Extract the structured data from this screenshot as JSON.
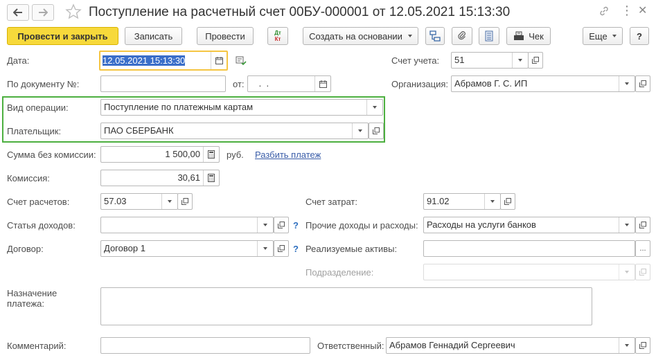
{
  "window": {
    "title": "Поступление на расчетный счет 00БУ-000001 от 12.05.2021 15:13:30",
    "more_icon": "⋮",
    "close_icon": "✕"
  },
  "toolbar": {
    "post_close": "Провести и закрыть",
    "save": "Записать",
    "post": "Провести",
    "dtkt_top": "Дт",
    "dtkt_bottom": "Кт",
    "create_based": "Создать на основании",
    "receipt": "Чек",
    "more": "Еще",
    "help": "?"
  },
  "form": {
    "date": {
      "label": "Дата:",
      "value": "12.05.2021 15:13:30"
    },
    "account": {
      "label": "Счет учета:",
      "value": "51"
    },
    "doc_number": {
      "label": "По документу №:",
      "value": ""
    },
    "from_label": "от:",
    "doc_date": {
      "value": " .  .    "
    },
    "organization": {
      "label": "Организация:",
      "value": "Абрамов Г. С. ИП"
    },
    "operation_type": {
      "label": "Вид операции:",
      "value": "Поступление по платежным картам"
    },
    "payer": {
      "label": "Плательщик:",
      "value": "ПАО СБЕРБАНК"
    },
    "amount": {
      "label": "Сумма без комиссии:",
      "value": "1 500,00",
      "currency": "руб.",
      "split_link": "Разбить платеж"
    },
    "commission": {
      "label": "Комиссия:",
      "value": "30,61"
    },
    "settlement_account": {
      "label": "Счет расчетов:",
      "value": "57.03"
    },
    "expense_account": {
      "label": "Счет затрат:",
      "value": "91.02"
    },
    "income_item": {
      "label": "Статья доходов:",
      "value": ""
    },
    "other_income": {
      "label": "Прочие доходы и расходы:",
      "value": "Расходы на услуги банков"
    },
    "contract": {
      "label": "Договор:",
      "value": "Договор 1"
    },
    "sold_assets": {
      "label": "Реализуемые активы:",
      "value": ""
    },
    "department": {
      "label": "Подразделение:",
      "value": ""
    },
    "purpose": {
      "label_line1": "Назначение",
      "label_line2": "платежа:",
      "value": ""
    },
    "comment": {
      "label": "Комментарий:",
      "value": ""
    },
    "responsible": {
      "label": "Ответственный:",
      "value": "Абрамов Геннадий Сергеевич"
    },
    "help_mark": "?",
    "ellipsis": "..."
  },
  "colors": {
    "primary_button": "#f7d93b",
    "highlight_frame": "#4caf3f",
    "date_focus": "#f5c542",
    "selection": "#3a6ec9",
    "link": "#3a5da8"
  }
}
